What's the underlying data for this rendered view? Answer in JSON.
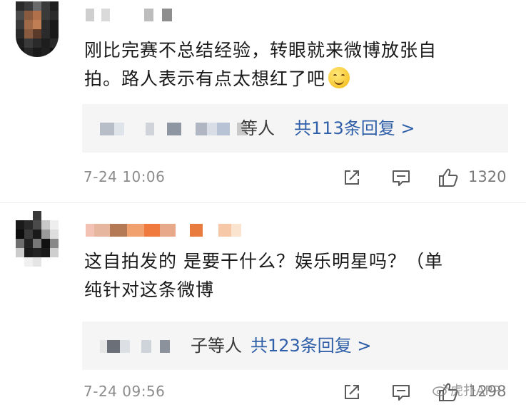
{
  "comments": [
    {
      "text_line1": "刚比完赛不总结经验，转眼就来微博放张自",
      "text_line2": "拍。路人表示有点太想红了吧",
      "emoji": "grinning-sweat-emoji",
      "reply_suffix": "等人",
      "reply_link": "共113条回复 >",
      "timestamp": "7-24 10:06",
      "like_count": "1320"
    },
    {
      "text_line1": "这自拍发的 是要干什么？娱乐明星吗？（单",
      "text_line2": "纯针对这条微博",
      "reply_suffix": "子等人",
      "reply_link": "共123条回复 >",
      "timestamp": "7-24 09:56",
      "like_count": "1298"
    }
  ],
  "watermark": {
    "text": "虎扑APP"
  },
  "colors": {
    "link": "#2e5fa8",
    "meta": "#8c8c8c",
    "reply_bg": "#f5f5f5"
  },
  "icons": [
    "share-icon",
    "comment-icon",
    "like-icon",
    "weibo-logo-icon"
  ]
}
